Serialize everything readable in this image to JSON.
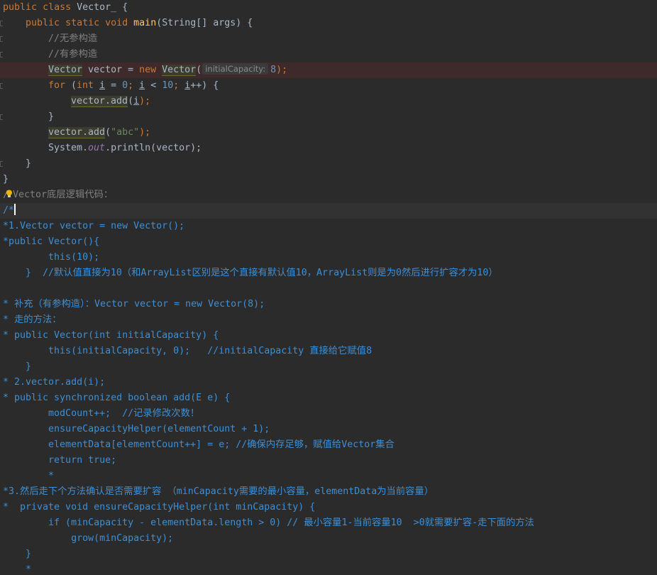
{
  "editor": {
    "class_decl": {
      "kw1": "public",
      "kw2": "class",
      "name": "Vector_",
      "brace": "{"
    },
    "main_decl": {
      "kw1": "public",
      "kw2": "static",
      "kw3": "void",
      "name": "main",
      "params": "(String[] args) {"
    },
    "comment_noarg": "//无参构造",
    "comment_witharg": "//有参构造",
    "vector_decl": {
      "type": "Vector",
      "var": " vector = ",
      "kw_new": "new",
      "ctor": "Vector",
      "paren": "(",
      "hint": "initialCapacity:",
      "arg": "8",
      "tail": ");"
    },
    "for_line": {
      "kw_for": "for",
      "p1": " (",
      "kw_int": "int",
      "var1": "i",
      "eq": " = ",
      "zero": "0",
      "semi1": "; ",
      "var2": "i",
      "lt": " < ",
      "ten": "10",
      "semi2": "; ",
      "var3": "i",
      "inc": "++) {"
    },
    "add_i": {
      "call": "vector.add",
      "open": "(",
      "var": "i",
      "close": ");"
    },
    "close_brace_for": "}",
    "add_abc": {
      "call": "vector.add",
      "open": "(",
      "str": "\"abc\"",
      "close": ");"
    },
    "println": {
      "pre": "System.",
      "field": "out",
      "post": ".println(vector);"
    },
    "close_brace_main": "}",
    "close_brace_class": "}",
    "comment_title_start": "/",
    "comment_title_rest": "Vector底层逻辑代码：",
    "comment_open": "/*",
    "doc_lines": [
      "*1.Vector vector = new Vector();",
      "*public Vector(){",
      "        this(10);",
      "    }  //默认值直接为10（和ArrayList区别是这个直接有默认值10，ArrayList则是为0然后进行扩容才为10）",
      "",
      "* 补充（有参构造）：Vector vector = new Vector(8);",
      "* 走的方法：",
      "* public Vector(int initialCapacity) {",
      "        this(initialCapacity, 0);   //initialCapacity 直接给它赋值8",
      "    }",
      "* 2.vector.add(i);",
      "* public synchronized boolean add(E e) {",
      "        modCount++;  //记录修改次数！",
      "        ensureCapacityHelper(elementCount + 1);",
      "        elementData[elementCount++] = e; //确保内存足够，赋值给Vector集合",
      "        return true;",
      "        *",
      "*3.然后走下个方法确认是否需要扩容 （minCapacity需要的最小容量，elementData为当前容量）",
      "*  private void ensureCapacityHelper(int minCapacity) {",
      "        if (minCapacity - elementData.length > 0) // 最小容量1-当前容量10  >0就需要扩容-走下面的方法",
      "            grow(minCapacity);",
      "    }",
      "    *"
    ]
  }
}
